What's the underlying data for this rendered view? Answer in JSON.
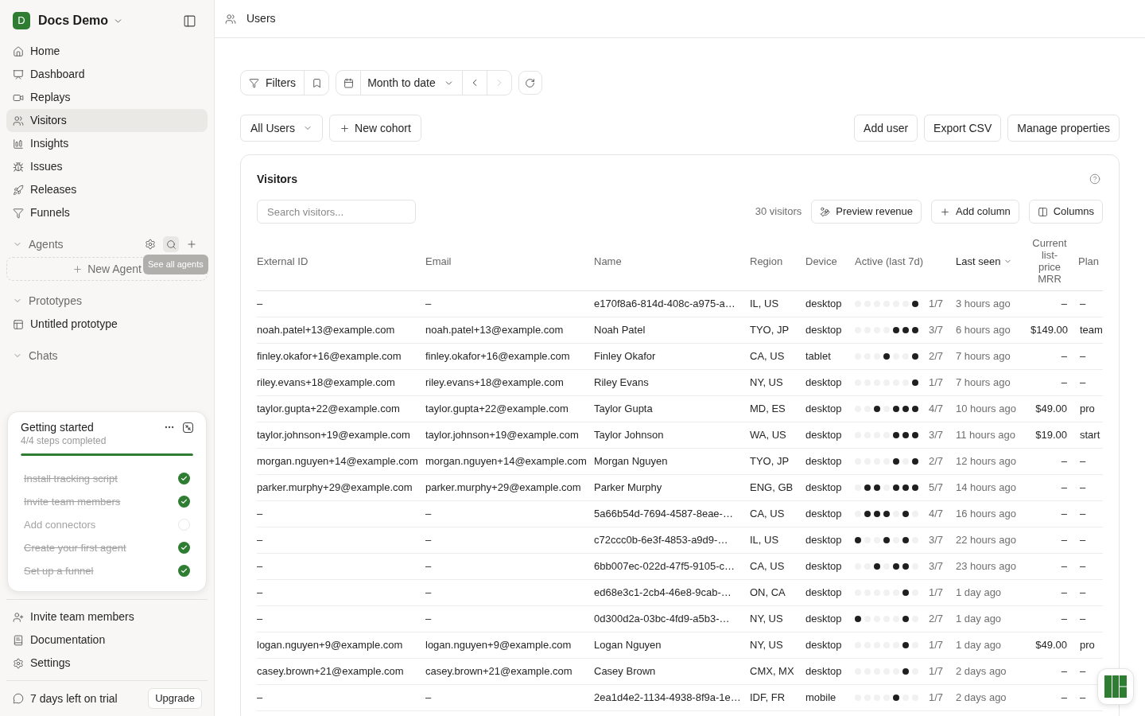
{
  "workspace": {
    "initial": "D",
    "name": "Docs Demo"
  },
  "sidebar": {
    "nav": [
      {
        "label": "Home",
        "selected": false
      },
      {
        "label": "Dashboard",
        "selected": false
      },
      {
        "label": "Replays",
        "selected": false
      },
      {
        "label": "Visitors",
        "selected": true
      },
      {
        "label": "Insights",
        "selected": false
      },
      {
        "label": "Issues",
        "selected": false
      },
      {
        "label": "Releases",
        "selected": false
      },
      {
        "label": "Funnels",
        "selected": false
      }
    ],
    "sections": [
      {
        "kind": "agents",
        "title": "Agents",
        "expanded": true,
        "new_button": "New Agent",
        "tooltip": "See all agents"
      },
      {
        "kind": "list",
        "title": "Prototypes",
        "expanded": true,
        "items": [
          {
            "label": "Untitled prototype"
          }
        ]
      },
      {
        "kind": "list",
        "title": "Chats",
        "expanded": true
      }
    ],
    "getting_started": {
      "title": "Getting started",
      "subtitle": "4/4 steps completed",
      "level": 1,
      "steps": [
        {
          "label": "Install tracking script",
          "done": true
        },
        {
          "label": "Invite team members",
          "done": true
        },
        {
          "label": "Add connectors",
          "done": false
        },
        {
          "label": "Create your first agent",
          "done": true
        },
        {
          "label": "Set up a funnel",
          "done": true
        }
      ]
    },
    "footer_nav": [
      {
        "label": "Invite team members"
      },
      {
        "label": "Documentation"
      },
      {
        "label": "Settings"
      }
    ],
    "trial": {
      "text": "7 days left on trial",
      "button": "Upgrade"
    }
  },
  "header": {
    "title": "Users"
  },
  "toolbar": {
    "filters": "Filters",
    "date_range": "Month to date",
    "prev": {
      "disabled": false
    },
    "next": {
      "disabled": true
    }
  },
  "cohort_bar": {
    "cohort": "All Users",
    "new_cohort": "New cohort",
    "actions": [
      "Add user",
      "Export CSV",
      "Manage properties"
    ]
  },
  "visitors": {
    "title": "Visitors",
    "search": {
      "placeholder": "Search visitors..."
    },
    "count": "30 visitors",
    "buttons": [
      "Preview revenue",
      "Add column",
      "Columns"
    ],
    "table": {
      "columns": [
        {
          "label": "External ID",
          "sorted": false
        },
        {
          "label": "Email",
          "sorted": false
        },
        {
          "label": "Name",
          "sorted": false
        },
        {
          "label": "Region",
          "sorted": false
        },
        {
          "label": "Device",
          "sorted": false
        },
        {
          "label": "Active (last 7d)",
          "sorted": false
        },
        {
          "label": "Last seen",
          "sorted": true
        },
        {
          "label": "Current list-price MRR",
          "sorted": false
        },
        {
          "label": "Plan",
          "sorted": false
        }
      ],
      "rows": [
        {
          "external_id": "–",
          "email": "–",
          "name": "e170f8a6-814d-408c-a975-a…",
          "region": "IL, US",
          "device": "desktop",
          "days": [
            false,
            false,
            false,
            false,
            false,
            false,
            true
          ],
          "active": "1/7",
          "last_seen": "3 hours ago",
          "mrr": "–",
          "plan": "–"
        },
        {
          "external_id": "noah.patel+13@example.com",
          "email": "noah.patel+13@example.com",
          "name": "Noah Patel",
          "region": "TYO, JP",
          "device": "desktop",
          "days": [
            false,
            false,
            false,
            false,
            true,
            true,
            true
          ],
          "active": "3/7",
          "last_seen": "6 hours ago",
          "mrr": "$149.00",
          "plan": "team"
        },
        {
          "external_id": "finley.okafor+16@example.com",
          "email": "finley.okafor+16@example.com",
          "name": "Finley Okafor",
          "region": "CA, US",
          "device": "tablet",
          "days": [
            false,
            false,
            false,
            true,
            false,
            false,
            true
          ],
          "active": "2/7",
          "last_seen": "7 hours ago",
          "mrr": "–",
          "plan": "–"
        },
        {
          "external_id": "riley.evans+18@example.com",
          "email": "riley.evans+18@example.com",
          "name": "Riley Evans",
          "region": "NY, US",
          "device": "desktop",
          "days": [
            false,
            false,
            false,
            false,
            false,
            false,
            true
          ],
          "active": "1/7",
          "last_seen": "7 hours ago",
          "mrr": "–",
          "plan": "–"
        },
        {
          "external_id": "taylor.gupta+22@example.com",
          "email": "taylor.gupta+22@example.com",
          "name": "Taylor Gupta",
          "region": "MD, ES",
          "device": "desktop",
          "days": [
            false,
            false,
            true,
            false,
            true,
            true,
            true
          ],
          "active": "4/7",
          "last_seen": "10 hours ago",
          "mrr": "$49.00",
          "plan": "pro"
        },
        {
          "external_id": "taylor.johnson+19@example.com",
          "email": "taylor.johnson+19@example.com",
          "name": "Taylor Johnson",
          "region": "WA, US",
          "device": "desktop",
          "days": [
            false,
            false,
            false,
            false,
            true,
            true,
            true
          ],
          "active": "3/7",
          "last_seen": "11 hours ago",
          "mrr": "$19.00",
          "plan": "start"
        },
        {
          "external_id": "morgan.nguyen+14@example.com",
          "email": "morgan.nguyen+14@example.com",
          "name": "Morgan Nguyen",
          "region": "TYO, JP",
          "device": "desktop",
          "days": [
            false,
            false,
            false,
            false,
            true,
            false,
            true
          ],
          "active": "2/7",
          "last_seen": "12 hours ago",
          "mrr": "–",
          "plan": "–"
        },
        {
          "external_id": "parker.murphy+29@example.com",
          "email": "parker.murphy+29@example.com",
          "name": "Parker Murphy",
          "region": "ENG, GB",
          "device": "desktop",
          "days": [
            false,
            true,
            true,
            false,
            true,
            true,
            true
          ],
          "active": "5/7",
          "last_seen": "14 hours ago",
          "mrr": "–",
          "plan": "–"
        },
        {
          "external_id": "–",
          "email": "–",
          "name": "5a66b54d-7694-4587-8eae-…",
          "region": "CA, US",
          "device": "desktop",
          "days": [
            false,
            true,
            true,
            true,
            false,
            true,
            false
          ],
          "active": "4/7",
          "last_seen": "16 hours ago",
          "mrr": "–",
          "plan": "–"
        },
        {
          "external_id": "–",
          "email": "–",
          "name": "c72ccc0b-6e3f-4853-a9d9-…",
          "region": "IL, US",
          "device": "desktop",
          "days": [
            true,
            false,
            false,
            true,
            false,
            true,
            false
          ],
          "active": "3/7",
          "last_seen": "22 hours ago",
          "mrr": "–",
          "plan": "–"
        },
        {
          "external_id": "–",
          "email": "–",
          "name": "6bb007ec-022d-47f5-9105-c…",
          "region": "CA, US",
          "device": "desktop",
          "days": [
            false,
            false,
            true,
            false,
            true,
            true,
            false
          ],
          "active": "3/7",
          "last_seen": "23 hours ago",
          "mrr": "–",
          "plan": "–"
        },
        {
          "external_id": "–",
          "email": "–",
          "name": "ed68e3c1-2cb4-46e8-9cab-…",
          "region": "ON, CA",
          "device": "desktop",
          "days": [
            false,
            false,
            false,
            false,
            false,
            true,
            false
          ],
          "active": "1/7",
          "last_seen": "1 day ago",
          "mrr": "–",
          "plan": "–"
        },
        {
          "external_id": "–",
          "email": "–",
          "name": "0d300d2a-03bc-4fd9-a5b3-…",
          "region": "NY, US",
          "device": "desktop",
          "days": [
            true,
            false,
            false,
            false,
            false,
            true,
            false
          ],
          "active": "2/7",
          "last_seen": "1 day ago",
          "mrr": "–",
          "plan": "–"
        },
        {
          "external_id": "logan.nguyen+9@example.com",
          "email": "logan.nguyen+9@example.com",
          "name": "Logan Nguyen",
          "region": "NY, US",
          "device": "desktop",
          "days": [
            false,
            false,
            false,
            false,
            false,
            true,
            false
          ],
          "active": "1/7",
          "last_seen": "1 day ago",
          "mrr": "$49.00",
          "plan": "pro"
        },
        {
          "external_id": "casey.brown+21@example.com",
          "email": "casey.brown+21@example.com",
          "name": "Casey Brown",
          "region": "CMX, MX",
          "device": "desktop",
          "days": [
            false,
            false,
            false,
            false,
            false,
            true,
            false
          ],
          "active": "1/7",
          "last_seen": "2 days ago",
          "mrr": "–",
          "plan": "–"
        },
        {
          "external_id": "–",
          "email": "–",
          "name": "2ea1d4e2-1134-4938-8f9a-1e…",
          "region": "IDF, FR",
          "device": "mobile",
          "days": [
            false,
            false,
            false,
            false,
            true,
            false,
            false
          ],
          "active": "1/7",
          "last_seen": "2 days ago",
          "mrr": "–",
          "plan": "–"
        }
      ]
    }
  }
}
